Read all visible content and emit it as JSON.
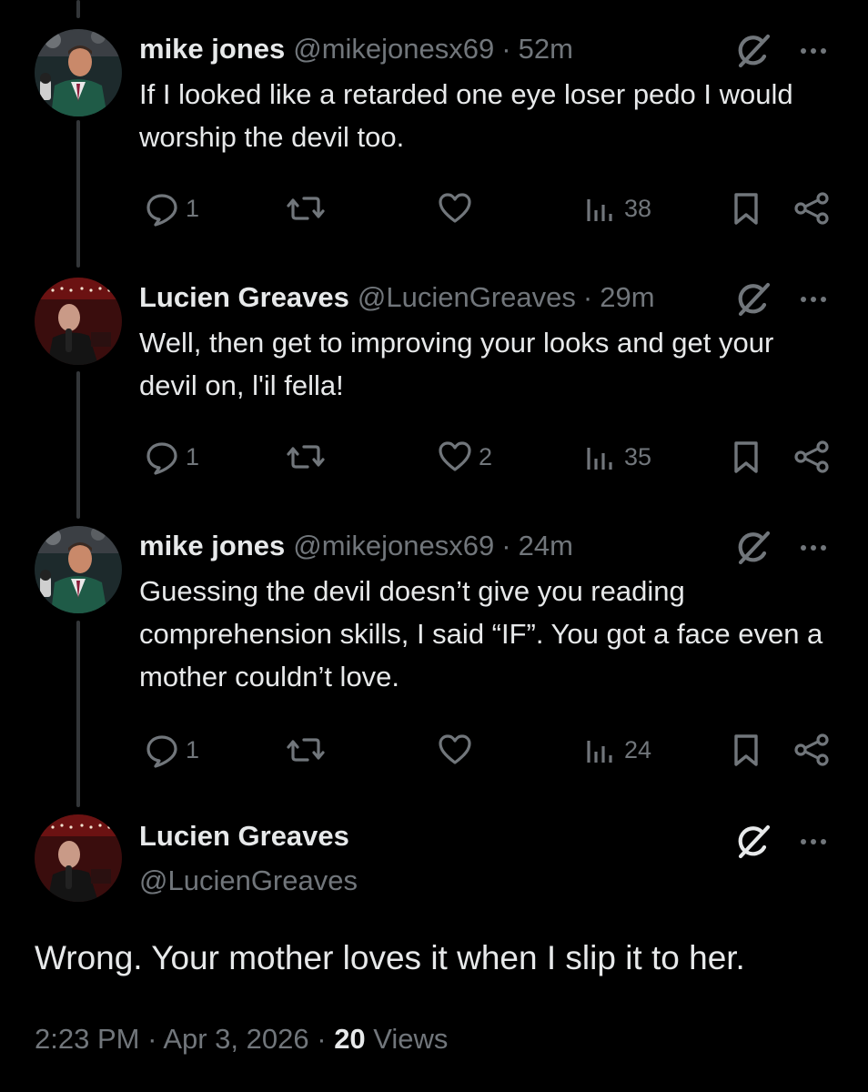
{
  "replies": [
    {
      "name": "mike jones",
      "handle": "@mikejonesx69",
      "separator": "·",
      "time": "52m",
      "avatar_icon": "avatar-mike-jones",
      "text": "If I looked like a retarded one eye loser pedo I would worship the devil too.",
      "replies": "1",
      "reposts": "",
      "likes": "",
      "views": "38"
    },
    {
      "name": "Lucien Greaves",
      "handle": "@LucienGreaves",
      "separator": "·",
      "time": "29m",
      "avatar_icon": "avatar-lucien-greaves",
      "text": "Well, then get to improving your looks and get your devil on, l'il fella!",
      "replies": "1",
      "reposts": "",
      "likes": "2",
      "views": "35"
    },
    {
      "name": "mike jones",
      "handle": "@mikejonesx69",
      "separator": "·",
      "time": "24m",
      "avatar_icon": "avatar-mike-jones",
      "text": "Guessing the devil doesn’t give you reading comprehension skills, I said “IF”. You got a face even a mother couldn’t love.",
      "replies": "1",
      "reposts": "",
      "likes": "",
      "views": "24"
    }
  ],
  "main_post": {
    "name": "Lucien Greaves",
    "handle": "@LucienGreaves",
    "avatar_icon": "avatar-lucien-greaves",
    "text": "Wrong. Your mother loves it when I slip it to her.",
    "time": "2:23 PM",
    "separator": "·",
    "date": "Apr 3, 2026",
    "views_count": "20",
    "views_label": "Views"
  },
  "icons": [
    "reply-icon",
    "repost-icon",
    "like-icon",
    "views-icon",
    "bookmark-icon",
    "share-icon",
    "grok-icon",
    "more-icon"
  ],
  "colors": {
    "background": "#000000",
    "primary_text": "#e7e9ea",
    "secondary_text": "#71767b",
    "thread_line": "#333639"
  }
}
